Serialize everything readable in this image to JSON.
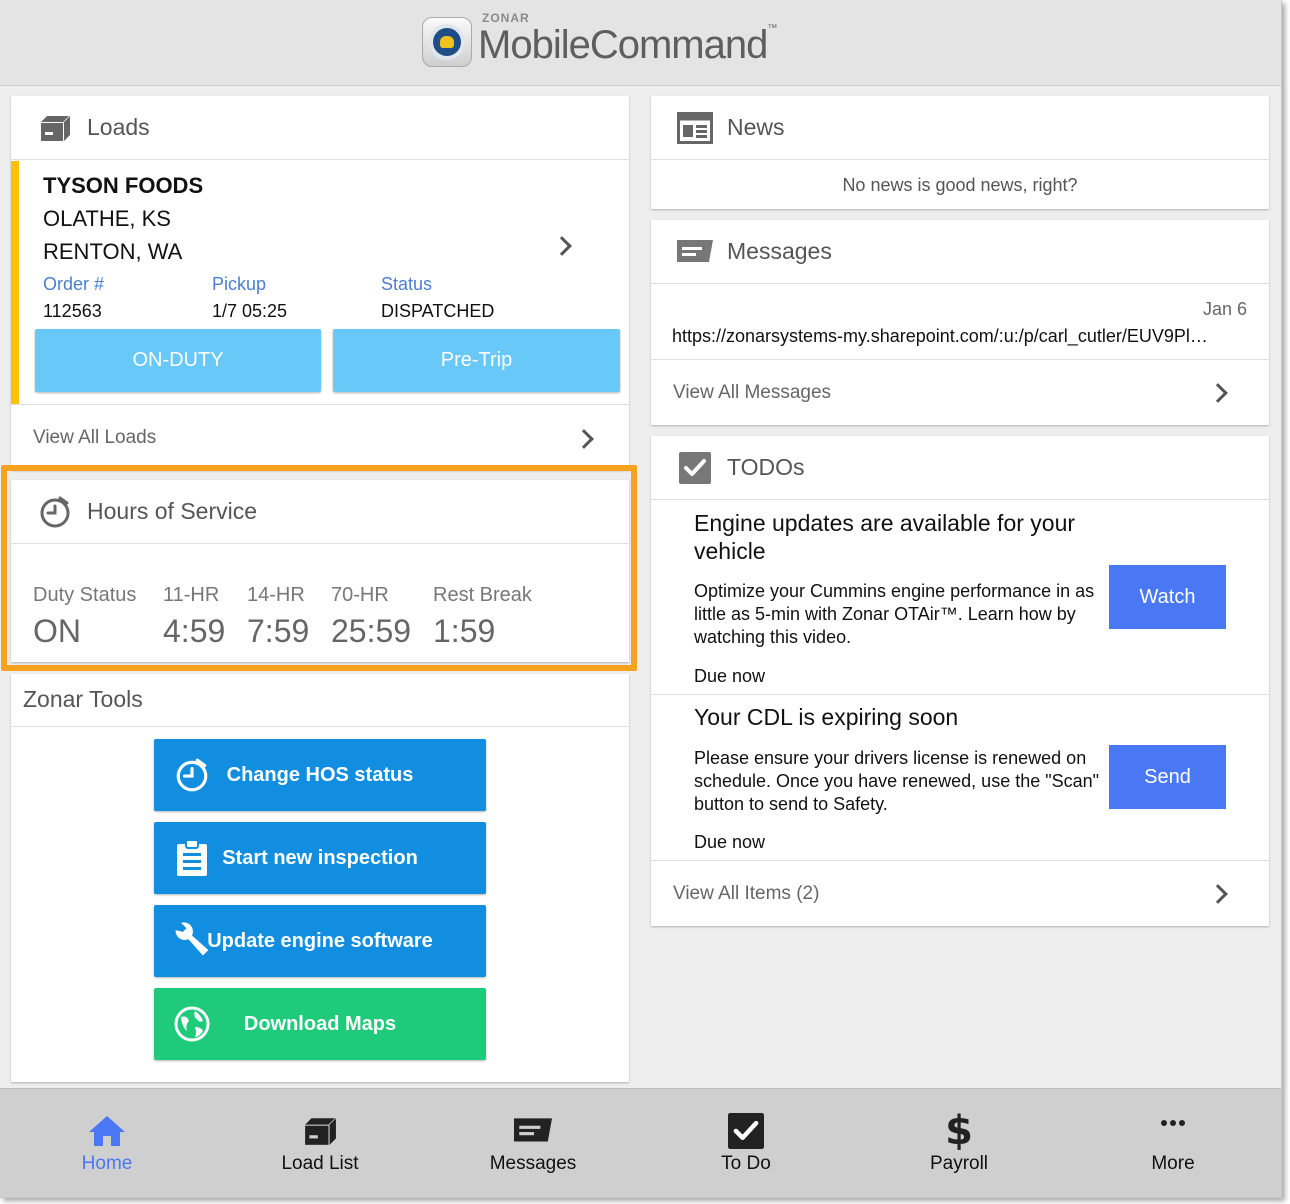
{
  "header": {
    "brand_small": "ZONAR",
    "brand_main": "MobileCommand",
    "brand_tm": "™"
  },
  "loads": {
    "title": "Loads",
    "customer": "TYSON FOODS",
    "origin": "OLATHE, KS",
    "destination": "RENTON, WA",
    "order_label": "Order #",
    "order_value": "112563",
    "pickup_label": "Pickup",
    "pickup_value": "1/7 05:25",
    "status_label": "Status",
    "status_value": "DISPATCHED",
    "btn_duty": "ON-DUTY",
    "btn_pretrip": "Pre-Trip",
    "view_all": "View All Loads",
    "accent": "#ffc107"
  },
  "hos": {
    "title": "Hours of Service",
    "duty_label": "Duty Status",
    "duty_value": "ON",
    "hr11_label": "11-HR",
    "hr11_value": "4:59",
    "hr14_label": "14-HR",
    "hr14_value": "7:59",
    "hr70_label": "70-HR",
    "hr70_value": "25:59",
    "rest_label": "Rest Break",
    "rest_value": "1:59",
    "highlight": "#f6a21e"
  },
  "tools": {
    "title": "Zonar Tools",
    "change_hos": "Change HOS status",
    "inspection": "Start new inspection",
    "engine": "Update engine software",
    "maps": "Download Maps",
    "blue": "#128ee0",
    "green": "#1fcb7a"
  },
  "news": {
    "title": "News",
    "empty": "No news is good news, right?"
  },
  "messages": {
    "title": "Messages",
    "date": "Jan 6",
    "preview": "https://zonarsystems-my.sharepoint.com/:u:/p/carl_cutler/EUV9Pl…",
    "view_all": "View All Messages"
  },
  "todos": {
    "title": "TODOs",
    "item1_title": "Engine updates are available for your vehicle",
    "item1_desc": "Optimize your Cummins engine performance in as little as 5-min with Zonar OTAir™.  Learn how by watching this video.",
    "item1_due": "Due now",
    "item1_btn": "Watch",
    "item2_title": "Your CDL is expiring soon",
    "item2_desc": "Please ensure your drivers license is renewed on schedule.  Once you have renewed, use the \"Scan\" button to send to Safety.",
    "item2_due": "Due now",
    "item2_btn": "Send",
    "view_all": "View All Items (2)",
    "button_color": "#4a78f5"
  },
  "nav": {
    "home": "Home",
    "load_list": "Load List",
    "messages": "Messages",
    "todo": "To Do",
    "payroll": "Payroll",
    "more": "More",
    "active_color": "#4a78f5"
  }
}
